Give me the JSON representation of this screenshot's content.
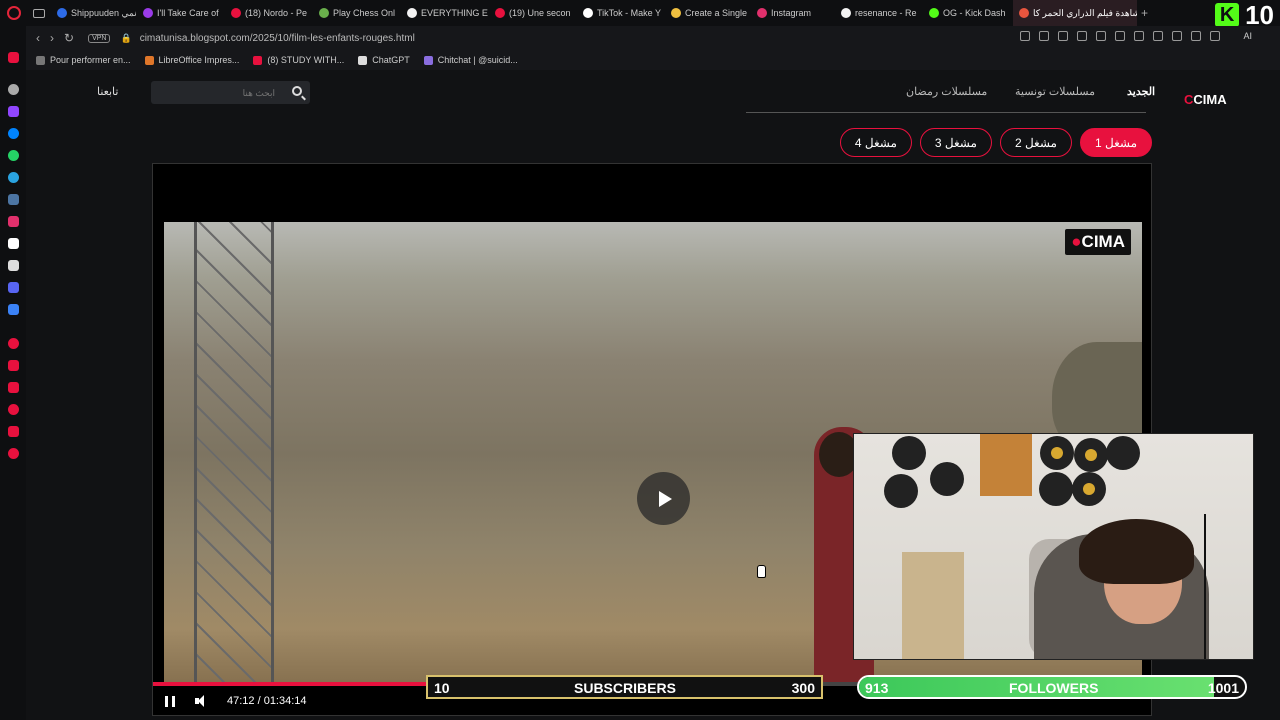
{
  "browser": {
    "tabs": [
      {
        "label": "Shippuuden انمي",
        "color": "#2d6be8"
      },
      {
        "label": "I'll Take Care of",
        "color": "#9a3be8"
      },
      {
        "label": "(18) Nordo - Pe",
        "color": "#e8113e"
      },
      {
        "label": "Play Chess Onl",
        "color": "#6ab04c"
      },
      {
        "label": "EVERYTHING E",
        "color": "#f3f3f3"
      },
      {
        "label": "(19) Une secon",
        "color": "#e8113e"
      },
      {
        "label": "TikTok - Make Y",
        "color": "#ffffff"
      },
      {
        "label": "Create a Single",
        "color": "#f0c040"
      },
      {
        "label": "Instagram",
        "color": "#e1306c"
      },
      {
        "label": "resenance - Re",
        "color": "#f3f3f3"
      },
      {
        "label": "OG - Kick Dash",
        "color": "#53fc18"
      },
      {
        "label": "مشاهدة فيلم الذراري الحمر كا",
        "color": "#e8553e",
        "active": true
      }
    ],
    "new_tab": "+",
    "url": "cimatunisa.blogspot.com/2025/10/film-les-enfants-rouges.html",
    "vpn": "VPN",
    "ai": "AI",
    "bookmarks": [
      {
        "label": "Pour performer en...",
        "color": "#777"
      },
      {
        "label": "LibreOffice Impres...",
        "color": "#e0772a"
      },
      {
        "label": "(8) STUDY WITH...",
        "color": "#e8113e"
      },
      {
        "label": "ChatGPT",
        "color": "#ddd"
      },
      {
        "label": "Chitchat | @suicid...",
        "color": "#8a6ee0"
      }
    ],
    "kick_count": "10"
  },
  "site": {
    "logo_prefix": "C",
    "logo_text": "CIMA",
    "nav": {
      "new": "الجديد",
      "tunisian_series": "مسلسلات تونسية",
      "ramadan_series": "مسلسلات رمضان"
    },
    "search_placeholder": "ابحث هنا",
    "follow": "تابعنا",
    "servers": [
      "مشغل 1",
      "مشغل 2",
      "مشغل 3",
      "مشغل 4"
    ],
    "active_server": 0
  },
  "player": {
    "watermark": "CIMA",
    "time": "47:12 / 01:34:14",
    "progress": 0.501
  },
  "overlay": {
    "subs_start": "10",
    "subs_label": "SUBSCRIBERS",
    "subs_end": "300",
    "subs_progress": 0.0,
    "followers_start": "913",
    "followers_label": "FOLLOWERS",
    "followers_end": "1001",
    "followers_progress": 0.92
  },
  "colors": {
    "accent": "#e8113e",
    "kick": "#53fc18",
    "bg": "#111214"
  }
}
